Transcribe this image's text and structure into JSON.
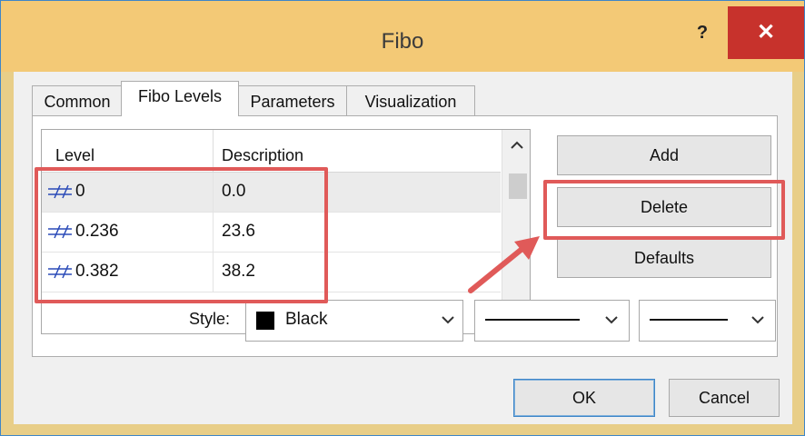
{
  "window": {
    "title": "Fibo",
    "help": "?",
    "close": "✕"
  },
  "tabs": [
    {
      "label": "Common"
    },
    {
      "label": "Fibo Levels"
    },
    {
      "label": "Parameters"
    },
    {
      "label": "Visualization"
    }
  ],
  "levels": {
    "columns": [
      "Level",
      "Description"
    ],
    "rows": [
      {
        "level": "0",
        "description": "0.0"
      },
      {
        "level": "0.236",
        "description": "23.6"
      },
      {
        "level": "0.382",
        "description": "38.2"
      }
    ]
  },
  "buttons": {
    "add": "Add",
    "delete": "Delete",
    "defaults": "Defaults",
    "ok": "OK",
    "cancel": "Cancel"
  },
  "style": {
    "label": "Style:",
    "color": "Black",
    "color_hex": "#000000"
  },
  "colors": {
    "titlebar": "#f3c976",
    "close": "#c7322c",
    "highlight": "#e05a59",
    "link_accent": "#3e86c8"
  }
}
